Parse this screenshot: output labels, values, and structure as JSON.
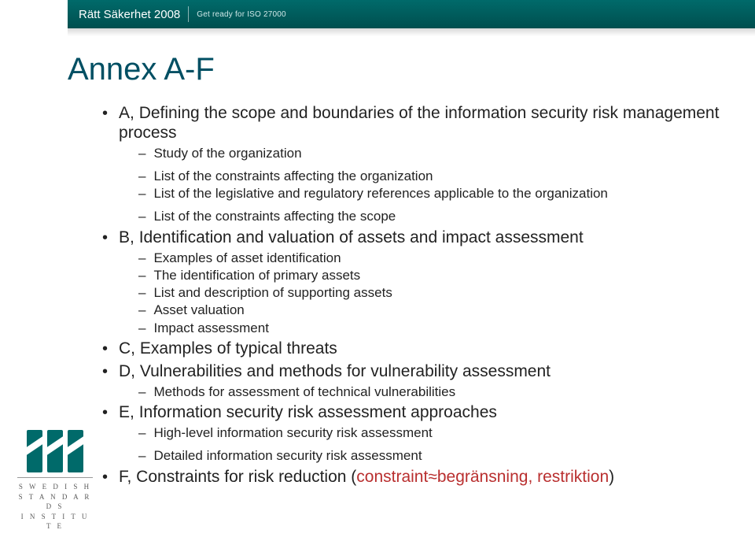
{
  "banner": {
    "title": "Rätt Säkerhet 2008",
    "tagline": "Get ready for ISO 27000"
  },
  "title": "Annex A-F",
  "logo": {
    "line1": "S W E D I S H",
    "line2": "S T A N D A R D S",
    "line3": "I N S T I T U T E"
  },
  "items": [
    {
      "label": "A, Defining the scope and boundaries of the information security risk management process",
      "children": [
        "Study of the organization",
        "__GAP__",
        "List of the constraints affecting the organization",
        "List of the legislative and regulatory references applicable to the organization",
        "__GAP__",
        "List of the constraints affecting the scope"
      ]
    },
    {
      "label": "B, Identification and valuation of assets and impact assessment",
      "children": [
        "Examples of asset identification",
        "The identification of primary assets",
        "List and description of supporting assets",
        "Asset valuation",
        "Impact assessment"
      ]
    },
    {
      "label": "C, Examples of typical threats",
      "children": []
    },
    {
      "label": "D, Vulnerabilities and methods for vulnerability assessment",
      "children": [
        "Methods for assessment of technical vulnerabilities"
      ]
    },
    {
      "label": "E, Information security risk assessment approaches",
      "children": [
        "High-level information security risk assessment",
        "__GAP__",
        "Detailed information security risk assessment"
      ]
    },
    {
      "label_html": "F, Constraints for risk reduction (<span class=\"accent\">constraint≈begränsning, restriktion</span>)",
      "children": []
    }
  ]
}
